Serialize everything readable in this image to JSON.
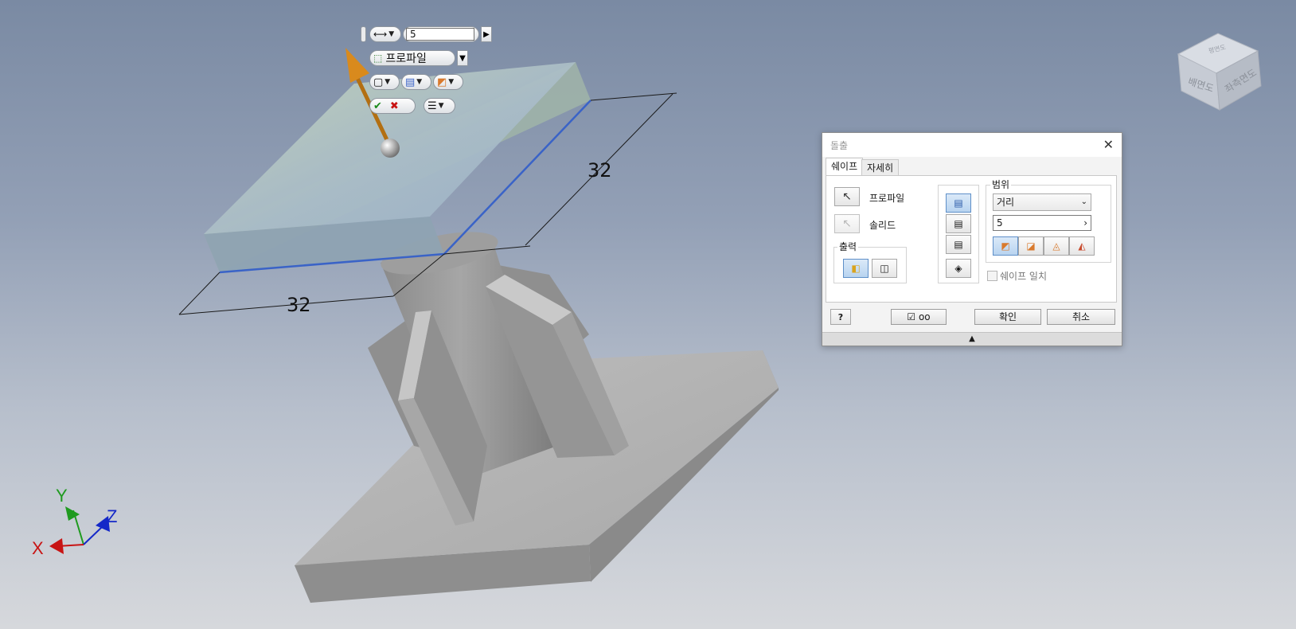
{
  "viewport": {
    "dimension_left": "32",
    "dimension_right": "32",
    "axes": {
      "x": "X",
      "y": "Y",
      "z": "Z"
    },
    "viewcube": {
      "face_front": "배면도",
      "face_right": "좌측면도",
      "face_top": "평면도"
    }
  },
  "minitoolbar": {
    "distance_value": "5",
    "profile_label": "프로파일"
  },
  "dialog": {
    "title": "돌출",
    "tabs": [
      "쉐이프",
      "자세히"
    ],
    "profile_label": "프로파일",
    "solid_label": "솔리드",
    "output_label": "출력",
    "extents_label": "범위",
    "extents_type": "거리",
    "distance_value": "5",
    "match_shape_label": "쉐이프 일치",
    "ok_label": "확인",
    "cancel_label": "취소"
  },
  "colors": {
    "accent_blue": "#3a63c7",
    "axis_x": "#c81414",
    "axis_y": "#1f9a1f",
    "axis_z": "#1428c8",
    "arrow": "#d98a1d"
  }
}
